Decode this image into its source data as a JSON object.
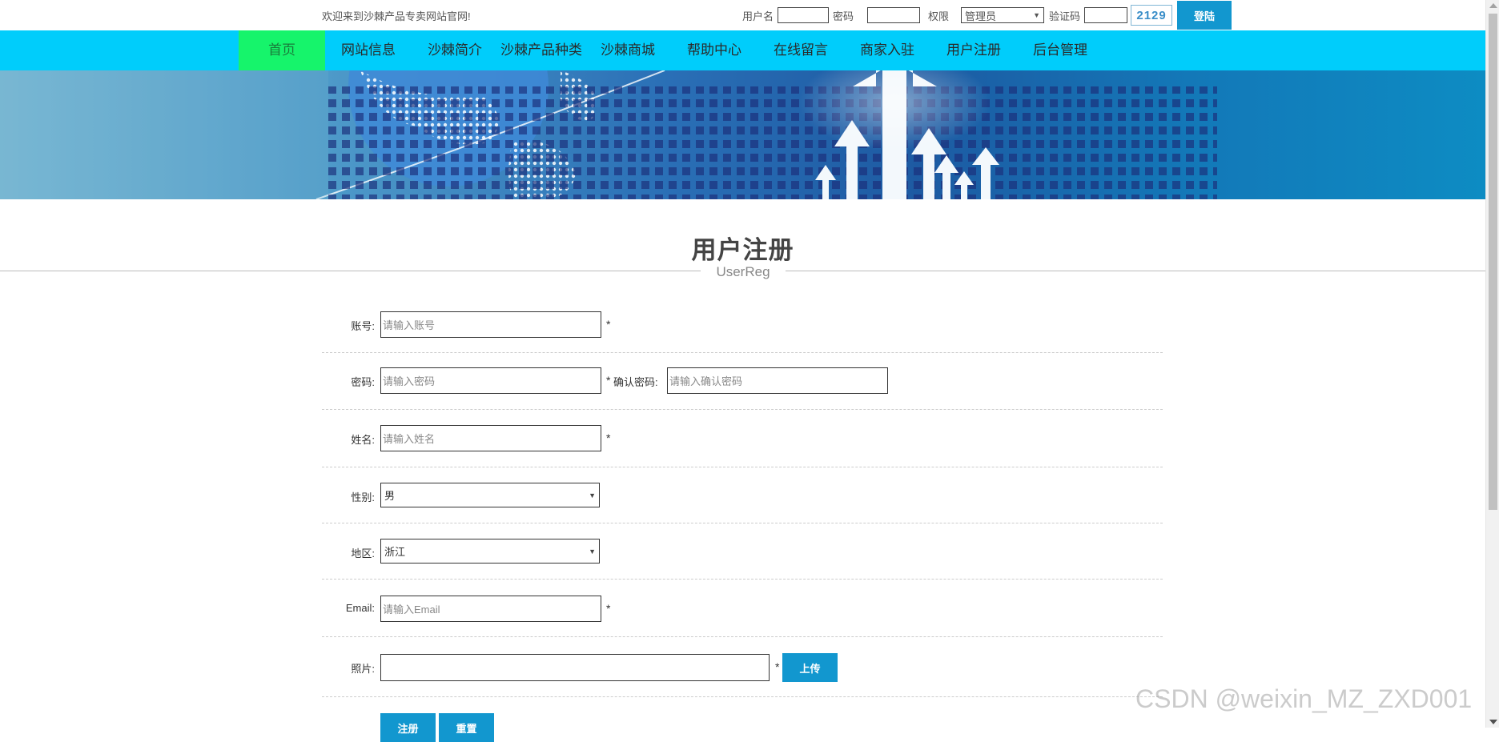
{
  "topbar": {
    "welcome": "欢迎来到沙棘产品专卖网站官网!",
    "username_label": "用户名",
    "password_label": "密码",
    "role_label": "权限",
    "role_value": "管理员",
    "captcha_label": "验证码",
    "captcha_code": "2129",
    "login_button": "登陆"
  },
  "nav": {
    "items": [
      "首页",
      "网站信息",
      "沙棘简介",
      "沙棘产品种类",
      "沙棘商城",
      "帮助中心",
      "在线留言",
      "商家入驻",
      "用户注册",
      "后台管理"
    ],
    "active_color": "#16f46b",
    "bar_color": "#00cdfb"
  },
  "page": {
    "title": "用户注册",
    "subtitle": "UserReg"
  },
  "form": {
    "account": {
      "label": "账号:",
      "placeholder": "请输入账号",
      "required": "*"
    },
    "password": {
      "label": "密码:",
      "placeholder": "请输入密码",
      "required": "*"
    },
    "confirm": {
      "label": "确认密码:",
      "placeholder": "请输入确认密码"
    },
    "name": {
      "label": "姓名:",
      "placeholder": "请输入姓名",
      "required": "*"
    },
    "gender": {
      "label": "性别:",
      "value": "男"
    },
    "region": {
      "label": "地区:",
      "value": "浙江"
    },
    "email": {
      "label": "Email:",
      "placeholder": "请输入Email",
      "required": "*"
    },
    "photo": {
      "label": "照片:",
      "required": "*",
      "upload_button": "上传"
    },
    "register_button": "注册",
    "reset_button": "重置"
  },
  "watermark": "CSDN @weixin_MZ_ZXD001",
  "colors": {
    "button": "#1297cf"
  }
}
